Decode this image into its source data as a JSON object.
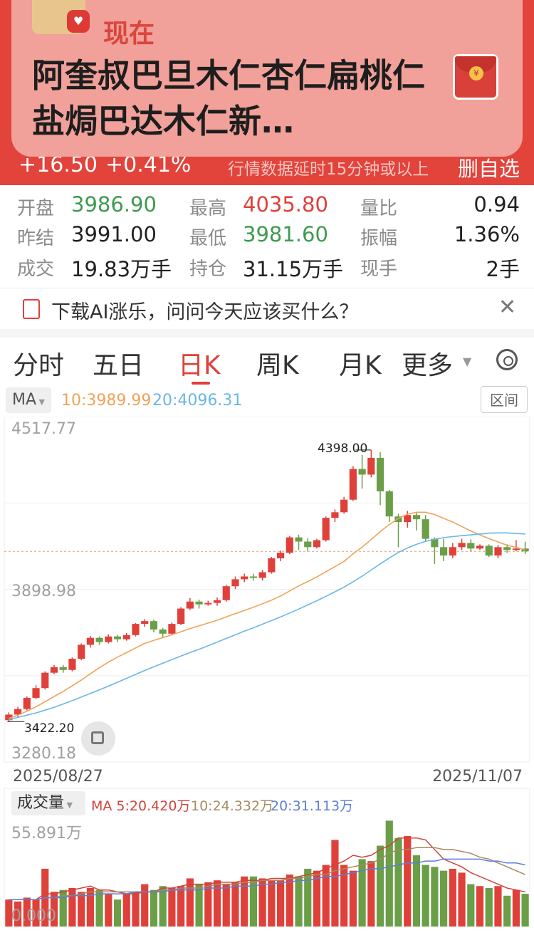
{
  "header": {
    "change": "+16.50",
    "change_pct": "+0.41%",
    "delay_note": "行情数据延时15分钟或以上",
    "delete_watchlist": "删自选"
  },
  "notification": {
    "app_name": "现在",
    "title": "阿奎叔巴旦木仁杏仁扁桃仁盐焗巴达木仁新…",
    "icon": "red-packet-icon"
  },
  "quote": {
    "open_label": "开盘",
    "open": "3986.90",
    "high_label": "最高",
    "high": "4035.80",
    "vol_ratio_label": "量比",
    "vol_ratio": "0.94",
    "prev_settle_label": "昨结",
    "prev_settle": "3991.00",
    "low_label": "最低",
    "low": "3981.60",
    "amplitude_label": "振幅",
    "amplitude": "1.36%",
    "volume_label": "成交",
    "volume": "19.83万手",
    "oi_label": "持仓",
    "oi": "31.15万手",
    "last_vol_label": "现手",
    "last_vol": "2手"
  },
  "ai_bar": {
    "text": "下载AI涨乐，问问今天应该买什么？"
  },
  "tabs": [
    "分时",
    "五日",
    "日K",
    "周K",
    "月K",
    "更多"
  ],
  "active_tab": "日K",
  "ma_bar": {
    "select": "MA",
    "ma10": "10:3989.99",
    "ma20": "20:4096.31",
    "interval_button": "区间"
  },
  "chart_labels": {
    "y_top": "4517.77",
    "y_mid": "3898.98",
    "y_bottom": "3280.18",
    "high_mark": "4398.00",
    "low_mark": "3422.20",
    "date_start": "2025/08/27",
    "date_end": "2025/11/07"
  },
  "volume_bar": {
    "select": "成交量",
    "ma5": "MA 5:20.420万",
    "ma10": "10:24.332万",
    "ma20": "20:31.113万",
    "y_top": "55.891万",
    "y_bottom": "0.000"
  },
  "colors": {
    "up": "#e0403a",
    "down": "#6a9e47",
    "ma10": "#f0a35a",
    "ma20": "#6ab7e6",
    "header": "#e2433b"
  },
  "chart_data": {
    "type": "candlestick",
    "x_range": [
      "2025/08/27",
      "2025/11/07"
    ],
    "ylim": [
      3280.18,
      4517.77
    ],
    "candles": [
      [
        3430,
        3450,
        3425,
        3458
      ],
      [
        3450,
        3470,
        3440,
        3478
      ],
      [
        3470,
        3510,
        3465,
        3515
      ],
      [
        3510,
        3545,
        3505,
        3555
      ],
      [
        3545,
        3600,
        3540,
        3605
      ],
      [
        3600,
        3620,
        3595,
        3628
      ],
      [
        3620,
        3610,
        3600,
        3628
      ],
      [
        3610,
        3650,
        3605,
        3655
      ],
      [
        3650,
        3700,
        3645,
        3705
      ],
      [
        3700,
        3725,
        3690,
        3732
      ],
      [
        3725,
        3710,
        3700,
        3730
      ],
      [
        3710,
        3730,
        3705,
        3738
      ],
      [
        3730,
        3720,
        3710,
        3735
      ],
      [
        3720,
        3735,
        3715,
        3742
      ],
      [
        3735,
        3775,
        3730,
        3778
      ],
      [
        3775,
        3785,
        3765,
        3792
      ],
      [
        3785,
        3755,
        3745,
        3790
      ],
      [
        3755,
        3740,
        3725,
        3760
      ],
      [
        3740,
        3775,
        3735,
        3780
      ],
      [
        3775,
        3830,
        3770,
        3835
      ],
      [
        3830,
        3855,
        3825,
        3868
      ],
      [
        3855,
        3845,
        3830,
        3862
      ],
      [
        3845,
        3850,
        3840,
        3858
      ],
      [
        3850,
        3860,
        3840,
        3870
      ],
      [
        3860,
        3910,
        3855,
        3915
      ],
      [
        3910,
        3935,
        3900,
        3945
      ],
      [
        3935,
        3945,
        3925,
        3955
      ],
      [
        3945,
        3940,
        3930,
        3955
      ],
      [
        3940,
        3960,
        3930,
        3968
      ],
      [
        3960,
        4010,
        3955,
        4015
      ],
      [
        4010,
        4030,
        4000,
        4038
      ],
      [
        4030,
        4085,
        4025,
        4090
      ],
      [
        4085,
        4070,
        4040,
        4095
      ],
      [
        4070,
        4050,
        4035,
        4082
      ],
      [
        4050,
        4075,
        4045,
        4080
      ],
      [
        4075,
        4155,
        4070,
        4160
      ],
      [
        4155,
        4175,
        4140,
        4185
      ],
      [
        4175,
        4220,
        4170,
        4230
      ],
      [
        4220,
        4330,
        4215,
        4340
      ],
      [
        4330,
        4310,
        4260,
        4380
      ],
      [
        4310,
        4370,
        4300,
        4398
      ],
      [
        4370,
        4250,
        4200,
        4390
      ],
      [
        4250,
        4160,
        4140,
        4255
      ],
      [
        4160,
        4140,
        4050,
        4170
      ],
      [
        4140,
        4165,
        4120,
        4180
      ],
      [
        4165,
        4150,
        4110,
        4175
      ],
      [
        4150,
        4080,
        4070,
        4165
      ],
      [
        4080,
        4050,
        3990,
        4085
      ],
      [
        4050,
        4020,
        4000,
        4080
      ],
      [
        4020,
        4050,
        4010,
        4065
      ],
      [
        4050,
        4065,
        4040,
        4080
      ],
      [
        4065,
        4045,
        4035,
        4078
      ],
      [
        4045,
        4055,
        4040,
        4060
      ],
      [
        4055,
        4020,
        4015,
        4060
      ],
      [
        4020,
        4050,
        4010,
        4058
      ],
      [
        4050,
        4040,
        4030,
        4060
      ],
      [
        4040,
        4045,
        4035,
        4075
      ],
      [
        4045,
        4035,
        4025,
        4070
      ]
    ],
    "ma10": [
      3436,
      3448,
      3462,
      3478,
      3496,
      3515,
      3533,
      3553,
      3574,
      3596,
      3618,
      3638,
      3656,
      3672,
      3689,
      3705,
      3716,
      3726,
      3736,
      3747,
      3758,
      3768,
      3778,
      3788,
      3800,
      3812,
      3823,
      3835,
      3847,
      3860,
      3875,
      3893,
      3911,
      3927,
      3943,
      3962,
      3980,
      3999,
      4026,
      4050,
      4077,
      4106,
      4131,
      4153,
      4168,
      4175,
      4175,
      4167,
      4153,
      4140,
      4124,
      4108,
      4094,
      4081,
      4069,
      4057,
      4049,
      4040
    ],
    "ma20": [
      3432,
      3440,
      3448,
      3456,
      3466,
      3476,
      3488,
      3500,
      3513,
      3526,
      3539,
      3552,
      3566,
      3580,
      3594,
      3608,
      3621,
      3634,
      3647,
      3660,
      3672,
      3684,
      3697,
      3710,
      3723,
      3736,
      3749,
      3761,
      3774,
      3787,
      3800,
      3814,
      3828,
      3843,
      3858,
      3874,
      3890,
      3907,
      3926,
      3946,
      3968,
      3990,
      4011,
      4031,
      4047,
      4060,
      4071,
      4078,
      4084,
      4088,
      4091,
      4094,
      4097,
      4100,
      4101,
      4101,
      4099,
      4097
    ],
    "volume": [
      14,
      13,
      15,
      14,
      30,
      18,
      19,
      20,
      18,
      20,
      19,
      17,
      14,
      17,
      18,
      22,
      19,
      21,
      20,
      21,
      25,
      22,
      23,
      24,
      22,
      23,
      26,
      26,
      25,
      24,
      24,
      27,
      26,
      30,
      29,
      32,
      45,
      32,
      29,
      35,
      34,
      42,
      55,
      46,
      47,
      37,
      32,
      31,
      29,
      30,
      28,
      22,
      21,
      20,
      21,
      16,
      19,
      17
    ],
    "vol_ma5": [
      14,
      14,
      14,
      14,
      17,
      17,
      18,
      19,
      20,
      21,
      19,
      19,
      18,
      17,
      17,
      18,
      18,
      20,
      20,
      21,
      22,
      22,
      22,
      23,
      23,
      23,
      24,
      24,
      24,
      25,
      25,
      25,
      26,
      27,
      28,
      30,
      32,
      34,
      37,
      36,
      37,
      40,
      42,
      46,
      46,
      46,
      45,
      40,
      35,
      33,
      31,
      28,
      26,
      24,
      22,
      20,
      19,
      18
    ],
    "vol_ma10": [
      14,
      14,
      14,
      14,
      15,
      15,
      16,
      16,
      17,
      18,
      18,
      18,
      18,
      18,
      18,
      18,
      18,
      19,
      19,
      20,
      20,
      20,
      21,
      22,
      22,
      22,
      23,
      23,
      24,
      24,
      24,
      25,
      25,
      26,
      27,
      27,
      29,
      30,
      31,
      32,
      33,
      35,
      38,
      40,
      40,
      41,
      41,
      41,
      40,
      40,
      39,
      38,
      36,
      35,
      33,
      31,
      29,
      27
    ],
    "vol_ma20": [
      14,
      14,
      14,
      14,
      15,
      15,
      15,
      16,
      16,
      16,
      17,
      17,
      17,
      17,
      18,
      18,
      18,
      18,
      19,
      19,
      19,
      19,
      20,
      20,
      20,
      21,
      21,
      21,
      22,
      22,
      23,
      23,
      24,
      24,
      25,
      26,
      26,
      27,
      28,
      29,
      30,
      30,
      31,
      32,
      33,
      33,
      34,
      34,
      35,
      35,
      35,
      35,
      35,
      34,
      34,
      33,
      33,
      32
    ]
  }
}
